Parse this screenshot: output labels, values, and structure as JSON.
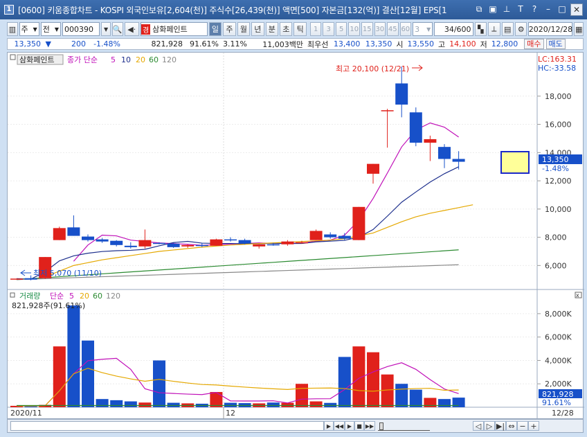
{
  "window": {
    "number": "1",
    "title": "[0600] 키움종합차트 - KOSPI 외국인보유[2,604(천)] 주식수[26,439(천)] 액면[500] 자본금[132(억)] 결산[12월] EPS[1"
  },
  "toolbar": {
    "period_select": "주",
    "prev_label": "전",
    "stock_code": "000390",
    "stock_name": "삼화페인트",
    "stock_badge": "경",
    "period_tabs": [
      "일",
      "주",
      "월",
      "년",
      "분",
      "초",
      "틱"
    ],
    "active_tab": "일",
    "minute_options": [
      "1",
      "3",
      "5",
      "10",
      "15",
      "30",
      "45",
      "60"
    ],
    "interval_value": "3",
    "count_value": "34",
    "count_total": "/600",
    "date_value": "2020/12/28"
  },
  "quote": {
    "price": "13,350",
    "change": "200",
    "change_pct": "-1.48%",
    "volume": "821,928",
    "vol_ratio": "91.61%",
    "turnover": "3.11%",
    "amount": "11,003백만",
    "priority_label": "최우선",
    "ask": "13,400",
    "bid": "13,350",
    "open_label": "시",
    "open": "13,550",
    "high_label": "고",
    "high": "14,100",
    "low_label": "저",
    "low": "12,800",
    "buy_label": "매수",
    "sell_label": "매도"
  },
  "price_panel": {
    "stock_label": "삼화페인트",
    "ma_label": "종가 단순",
    "ma_periods": [
      "5",
      "10",
      "20",
      "60",
      "120"
    ],
    "ma_colors": [
      "#c010b8",
      "#1c2e8c",
      "#e5a800",
      "#2a8a30",
      "#888888"
    ],
    "lc_label": "LC:163.31",
    "hc_label": "HC:-33.58",
    "high_annotation": "최고 20,100 (12/21)",
    "low_annotation": "최저 5,070 (11/10)",
    "current_price_tag": "13,350",
    "current_pct_tag": "-1.48%",
    "y_ticks": [
      "18,000",
      "16,000",
      "14,000",
      "12,000",
      "10,000",
      "8,000",
      "6,000"
    ]
  },
  "volume_panel": {
    "label": "거래량",
    "ma_label": "단순",
    "ma_periods": [
      "5",
      "20",
      "60",
      "120"
    ],
    "current_label": "821,928주(91.61%)",
    "y_ticks": [
      "8,000K",
      "6,000K",
      "4,000K",
      "2,000K"
    ],
    "current_tag": "821,928",
    "current_pct": "91.61%"
  },
  "x_axis": {
    "labels": [
      "2020/11",
      "12"
    ],
    "end_label": "12/28"
  },
  "chart_data": {
    "type": "candlestick",
    "series": [
      {
        "name": "price",
        "candles": [
          {
            "o": 5070,
            "h": 5070,
            "l": 5000,
            "c": 5070,
            "up": true
          },
          {
            "o": 5100,
            "h": 5300,
            "l": 4950,
            "c": 5000,
            "up": false
          },
          {
            "o": 5100,
            "h": 6600,
            "l": 5050,
            "c": 6600,
            "up": true
          },
          {
            "o": 7800,
            "h": 8750,
            "l": 7800,
            "c": 8650,
            "up": true
          },
          {
            "o": 8700,
            "h": 9550,
            "l": 8100,
            "c": 8100,
            "up": false
          },
          {
            "o": 8050,
            "h": 8200,
            "l": 7700,
            "c": 7800,
            "up": false
          },
          {
            "o": 7850,
            "h": 7950,
            "l": 7600,
            "c": 7700,
            "up": false
          },
          {
            "o": 7750,
            "h": 7800,
            "l": 7350,
            "c": 7450,
            "up": false
          },
          {
            "o": 7400,
            "h": 7650,
            "l": 7200,
            "c": 7300,
            "up": false
          },
          {
            "o": 7350,
            "h": 8550,
            "l": 7200,
            "c": 7800,
            "up": true
          },
          {
            "o": 7600,
            "h": 7650,
            "l": 7500,
            "c": 7550,
            "up": false
          },
          {
            "o": 7550,
            "h": 7600,
            "l": 7250,
            "c": 7300,
            "up": false
          },
          {
            "o": 7350,
            "h": 7500,
            "l": 7250,
            "c": 7450,
            "up": true
          },
          {
            "o": 7450,
            "h": 7600,
            "l": 7300,
            "c": 7400,
            "up": false
          },
          {
            "o": 7400,
            "h": 7900,
            "l": 7400,
            "c": 7850,
            "up": true
          },
          {
            "o": 7850,
            "h": 8000,
            "l": 7700,
            "c": 7800,
            "up": false
          },
          {
            "o": 7800,
            "h": 7900,
            "l": 7500,
            "c": 7550,
            "up": false
          },
          {
            "o": 7350,
            "h": 7500,
            "l": 7200,
            "c": 7500,
            "up": true
          },
          {
            "o": 7500,
            "h": 7600,
            "l": 7400,
            "c": 7450,
            "up": false
          },
          {
            "o": 7500,
            "h": 7800,
            "l": 7400,
            "c": 7700,
            "up": true
          },
          {
            "o": 7650,
            "h": 7750,
            "l": 7550,
            "c": 7600,
            "up": true
          },
          {
            "o": 7800,
            "h": 8550,
            "l": 7800,
            "c": 8450,
            "up": true
          },
          {
            "o": 8200,
            "h": 8350,
            "l": 7900,
            "c": 8000,
            "up": false
          },
          {
            "o": 8100,
            "h": 8300,
            "l": 7800,
            "c": 7900,
            "up": false
          },
          {
            "o": 7800,
            "h": 10150,
            "l": 7800,
            "c": 10150,
            "up": true
          },
          {
            "o": 12500,
            "h": 13200,
            "l": 11800,
            "c": 13200,
            "up": true
          },
          {
            "o": 17000,
            "h": 17100,
            "l": 14350,
            "c": 17000,
            "up": true
          },
          {
            "o": 18900,
            "h": 20100,
            "l": 16500,
            "c": 17400,
            "up": false
          },
          {
            "o": 16850,
            "h": 17200,
            "l": 14450,
            "c": 14700,
            "up": false
          },
          {
            "o": 14950,
            "h": 15200,
            "l": 13400,
            "c": 14700,
            "up": true
          },
          {
            "o": 14400,
            "h": 14600,
            "l": 12900,
            "c": 13550,
            "up": false
          },
          {
            "o": 13550,
            "h": 14100,
            "l": 12800,
            "c": 13350,
            "up": false
          }
        ]
      },
      {
        "name": "volume",
        "values": [
          120,
          80,
          200,
          5200,
          8700,
          5700,
          700,
          600,
          500,
          400,
          4000,
          380,
          330,
          300,
          1300,
          380,
          350,
          330,
          400,
          380,
          2000,
          500,
          370,
          4300,
          5200,
          4700,
          2800,
          2000,
          1500,
          800,
          700,
          822
        ]
      }
    ],
    "ma5": [
      null,
      null,
      null,
      null,
      6300,
      7450,
      8150,
      8100,
      7800,
      7700,
      7600,
      7550,
      7500,
      7430,
      7470,
      7520,
      7560,
      7600,
      7560,
      7570,
      7590,
      7720,
      7800,
      8150,
      9200,
      10750,
      12550,
      14400,
      15600,
      16100,
      15800,
      15100
    ],
    "ma20": [
      null,
      null,
      5200,
      5600,
      6000,
      6200,
      6400,
      6550,
      6700,
      6850,
      7000,
      7100,
      7200,
      7300,
      7380,
      7450,
      7500,
      7560,
      7600,
      7650,
      7700,
      7750,
      7800,
      7900,
      8100,
      8300,
      8700,
      9100,
      9450,
      9700,
      9900,
      10100,
      10300
    ],
    "ylim": [
      4300,
      20100
    ],
    "vol_ylim": [
      0,
      9000
    ]
  }
}
